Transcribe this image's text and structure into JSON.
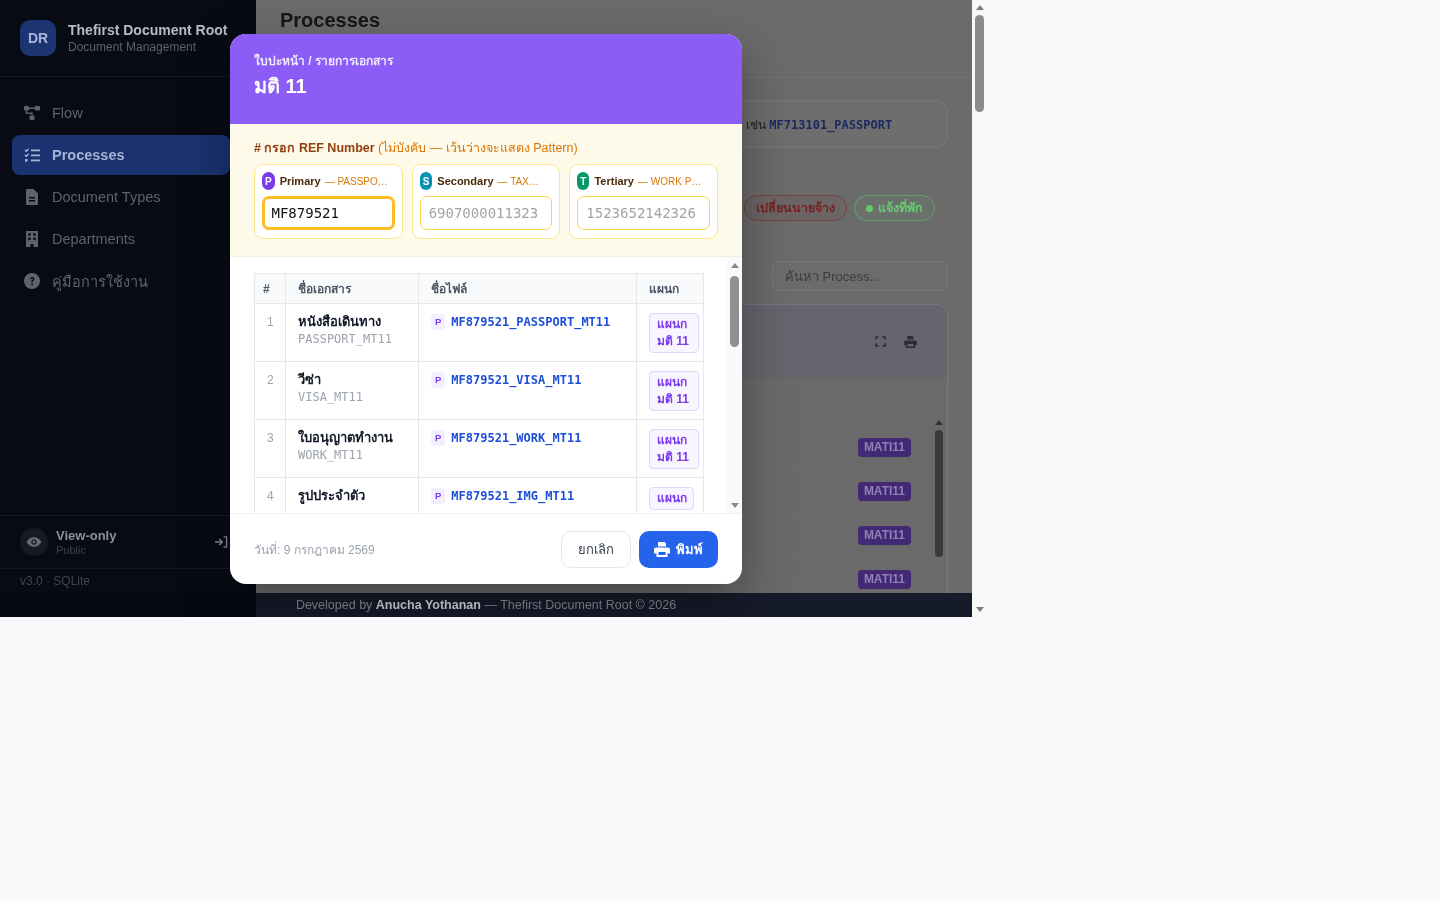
{
  "sidebar": {
    "logo": "DR",
    "app_name": "Thefirst Document Root",
    "app_subtitle": "Document Management",
    "nav_items": [
      {
        "label": "Flow",
        "selected": false
      },
      {
        "label": "Processes",
        "selected": true
      },
      {
        "label": "Document Types",
        "selected": false
      },
      {
        "label": "Departments",
        "selected": false
      },
      {
        "label": "คู่มือการใช้งาน",
        "selected": false
      }
    ],
    "user": {
      "name": "View-only",
      "role": "Public"
    },
    "version": "v3.0 · SQLite"
  },
  "page": {
    "title": "Processes",
    "example": "เช่น **MF713101_PASSPORT**",
    "tags": [
      {
        "label": "เปลี่ยนนายจ้าง",
        "color": "#7a1f1f",
        "dot": false
      },
      {
        "label": "แจ้งที่พัก",
        "color": "#62cc6f",
        "dot": true
      }
    ],
    "search": {
      "placeholder": "ค้นหา Process..."
    },
    "rows": [
      {
        "badge": "MATI11"
      },
      {
        "badge": "MATI11"
      },
      {
        "badge": "MATI11"
      },
      {
        "badge": "MATI11"
      }
    ]
  },
  "modal": {
    "breadcrumb": "ใบปะหน้า / รายการเอกสาร",
    "title": "มติ 11",
    "ref_label": "**# กรอก REF Number** (ไม่บังคับ — เว้นว่างจะแสดง Pattern)",
    "ref_slots": [
      {
        "badge": "P",
        "color": "#7c3aed",
        "label": "Primary",
        "hint": "— PASSPO…",
        "value": "MF879521",
        "focused": true
      },
      {
        "badge": "S",
        "color": "#0891b2",
        "label": "Secondary",
        "hint": "— TAX…",
        "placeholder": "6907000011323",
        "focused": false
      },
      {
        "badge": "T",
        "color": "#059669",
        "label": "Tertiary",
        "hint": "— WORK P…",
        "placeholder": "1523652142326",
        "focused": false
      }
    ],
    "table": {
      "columns": [
        "#",
        "ชื่อเอกสาร",
        "ชื่อไฟล์",
        "แผนก"
      ],
      "rows": [
        {
          "no": "1",
          "name": "หนังสือเดินทาง",
          "code": "PASSPORT_MT11",
          "file_tag": "P",
          "file": "MF879521_PASSPORT_MT11",
          "department": "แผนก มติ 11"
        },
        {
          "no": "2",
          "name": "วีซ่า",
          "code": "VISA_MT11",
          "file_tag": "P",
          "file": "MF879521_VISA_MT11",
          "department": "แผนก มติ 11"
        },
        {
          "no": "3",
          "name": "ใบอนุญาตทำงาน",
          "code": "WORK_MT11",
          "file_tag": "P",
          "file": "MF879521_WORK_MT11",
          "department": "แผนก มติ 11"
        },
        {
          "no": "4",
          "name": "รูปประจำตัว",
          "file_tag": "P",
          "file": "MF879521_IMG_MT11",
          "department": "แผนก"
        }
      ]
    },
    "date": "วันที่: 9 กรกฎาคม 2569",
    "buttons": [
      {
        "label": "ยกเลิก",
        "kind": "secondary"
      },
      {
        "label": "พิมพ์",
        "kind": "primary"
      }
    ]
  },
  "footer": "Developed by **Anucha Yothanan** — Thefirst Document Root © 2026"
}
